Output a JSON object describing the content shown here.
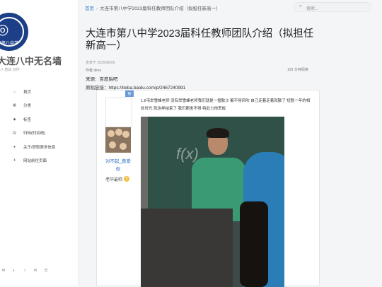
{
  "site": {
    "logo_text": "大连市第八中学",
    "title": "大连八中无名墙",
    "subtitle": "八 若站 创作"
  },
  "nav": [
    {
      "icon": "home-icon",
      "glyph": "⌂",
      "label": "首页"
    },
    {
      "icon": "grid-icon",
      "glyph": "▦",
      "label": "分类"
    },
    {
      "icon": "tag-icon",
      "glyph": "◆",
      "label": "标签"
    },
    {
      "icon": "archive-icon",
      "glyph": "▤",
      "label": "归档(时间线)"
    },
    {
      "icon": "info-icon",
      "glyph": "●",
      "label": "关于/获取更多信息"
    },
    {
      "icon": "share-icon",
      "glyph": "✈",
      "label": "网站前往页面"
    }
  ],
  "social": [
    "✉",
    "◐",
    "○",
    "✉",
    "☰"
  ],
  "breadcrumb": {
    "home": "首页",
    "current": "大连市第八中学2023届科任教师团队介绍（拟担任新高一）"
  },
  "search": {
    "placeholder": "搜索..."
  },
  "article": {
    "title": "大连市第八中学2023届科任教师团队介绍（拟担任新高一）",
    "published": "发表于 2025/06/06",
    "author": "作者 dimo",
    "read_time": "103 分钟阅读",
    "source": "来源：百度贴吧",
    "source_link": "原贴链接：https://tieba.baidu.com/p/2467240991"
  },
  "post": {
    "badge": "楼",
    "user_name": "对不起_莪爱你",
    "user_rank": "老毕最帅",
    "user_level": "9",
    "text": "1.8韦举雪峰老师 没有举雪峰老师我们就是一盘散沙 都不用风吹 自己走着走着就散了 短暂一年的相处时光 就这样结束了 我们都舍不得 特此力他丢板",
    "board_text": "f(x)"
  }
}
